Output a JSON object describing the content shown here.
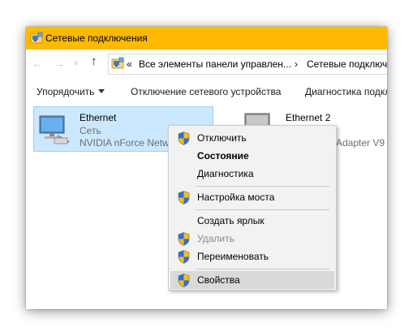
{
  "window": {
    "title": "Сетевые подключения",
    "accent_color": "#ffb900"
  },
  "address": {
    "back_icon": "←",
    "forward_icon": "→",
    "dropdown_icon": "∨",
    "up_icon": "↑",
    "overflow_label": "«",
    "segment_1": "Все элементы панели управлен...",
    "separator": "›",
    "segment_2": "Сетевые подключ"
  },
  "toolbar": {
    "organize_label": "Упорядочить",
    "disable_label": "Отключение сетевого устройства",
    "diagnostics_label": "Диагностика подкл"
  },
  "adapters": [
    {
      "name": "Ethernet",
      "network": "Сеть",
      "device": "NVIDIA nForce Netw",
      "selected": true
    },
    {
      "name": "Ethernet 2",
      "device": "Adapter V9"
    }
  ],
  "context_menu": {
    "items": [
      {
        "label": "Отключить",
        "shield": true
      },
      {
        "label": "Состояние",
        "bold": true
      },
      {
        "label": "Диагностика"
      },
      {
        "label": "Настройка моста",
        "shield": true
      },
      {
        "label": "Создать ярлык"
      },
      {
        "label": "Удалить",
        "shield": true,
        "disabled": true
      },
      {
        "label": "Переименовать",
        "shield": true
      },
      {
        "label": "Свойства",
        "shield": true,
        "highlighted": true
      }
    ]
  }
}
